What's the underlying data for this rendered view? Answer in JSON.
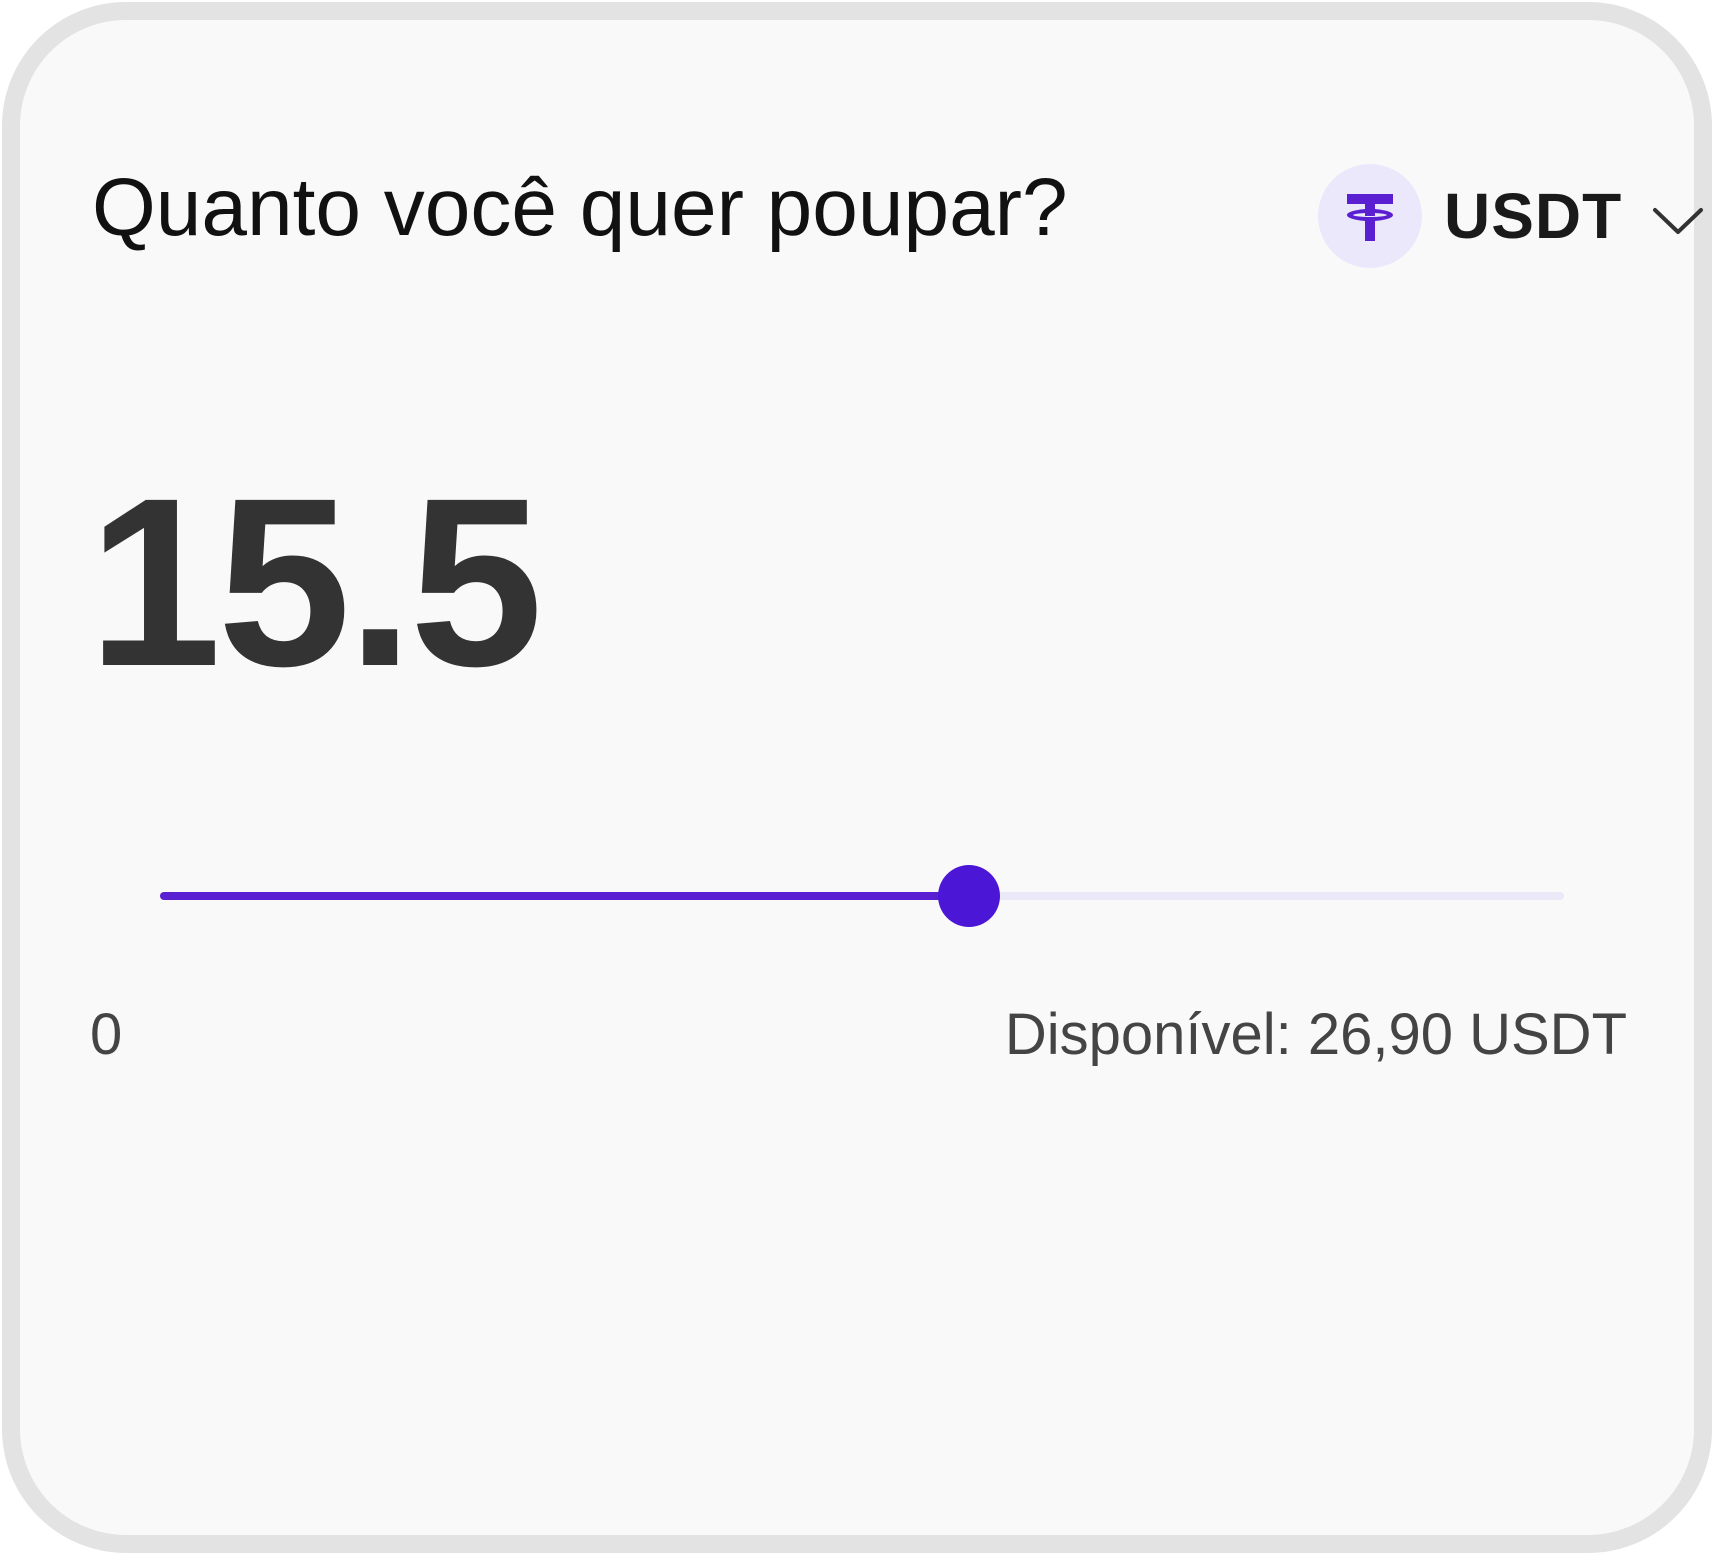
{
  "question": "Quanto você quer poupar?",
  "token": {
    "symbol": "USDT",
    "icon": "tether-icon",
    "dropdown_icon": "chevron-down-icon"
  },
  "amount": "15.5",
  "slider": {
    "min_label": "0",
    "min": 0,
    "max": 26.9,
    "value": 15.5
  },
  "available_text": "Disponível: 26,90 USDT",
  "colors": {
    "accent": "#4c16d6",
    "track": "#ebe8f7",
    "icon_bg": "#ece8fb"
  }
}
